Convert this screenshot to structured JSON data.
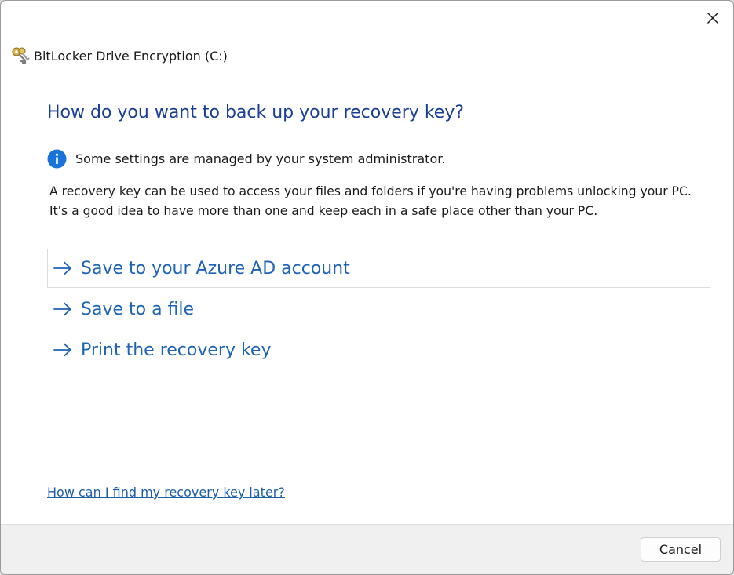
{
  "window": {
    "title": "BitLocker Drive Encryption (C:)",
    "app_icon": "bitlocker-keys-icon",
    "close_icon": "close-icon"
  },
  "main": {
    "heading": "How do you want to back up your recovery key?",
    "info": {
      "icon": "info-icon",
      "text": "Some settings are managed by your system administrator."
    },
    "description": [
      "A recovery key can be used to access your files and folders if you're having problems unlocking your PC.",
      "It's a good idea to have more than one and keep each in a safe place other than your PC."
    ],
    "options": [
      {
        "label": "Save to your Azure AD account",
        "icon": "arrow-right-icon"
      },
      {
        "label": "Save to a file",
        "icon": "arrow-right-icon"
      },
      {
        "label": "Print the recovery key",
        "icon": "arrow-right-icon"
      }
    ],
    "help_link": "How can I find my recovery key later?"
  },
  "footer": {
    "cancel_label": "Cancel"
  },
  "colors": {
    "heading": "#1a3e96",
    "option_text": "#1f63b4",
    "link": "#1c5fa8",
    "info_icon": "#1a73d9"
  }
}
